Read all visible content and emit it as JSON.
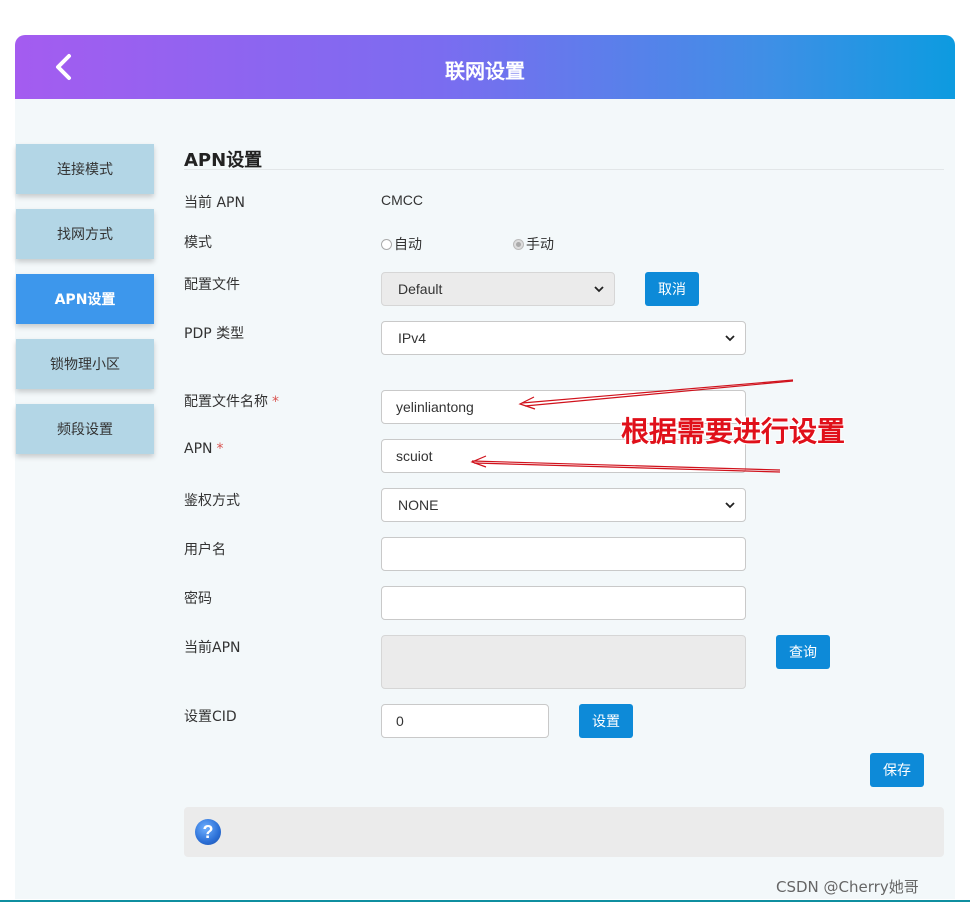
{
  "header": {
    "title": "联网设置"
  },
  "sidebar": {
    "items": [
      {
        "label": "连接模式",
        "active": false
      },
      {
        "label": "找网方式",
        "active": false
      },
      {
        "label": "APN设置",
        "active": true
      },
      {
        "label": "锁物理小区",
        "active": false
      },
      {
        "label": "频段设置",
        "active": false
      }
    ]
  },
  "section": {
    "title": "APN设置"
  },
  "form": {
    "current_apn_label": "当前 APN",
    "current_apn_value": "CMCC",
    "mode_label": "模式",
    "mode_options": [
      {
        "label": "自动",
        "checked": false
      },
      {
        "label": "手动",
        "checked": true
      }
    ],
    "profile_label": "配置文件",
    "profile_value": "Default",
    "cancel_label": "取消",
    "pdp_label": "PDP 类型",
    "pdp_value": "IPv4",
    "profile_name_label": "配置文件名称",
    "profile_name_value": "yelinliantong",
    "apn_label": "APN",
    "apn_value": "scuiot",
    "required_mark": "*",
    "auth_label": "鉴权方式",
    "auth_value": "NONE",
    "username_label": "用户名",
    "username_value": "",
    "password_label": "密码",
    "password_value": "",
    "current_apn2_label": "当前APN",
    "current_apn2_value": "",
    "query_label": "查询",
    "cid_label": "设置CID",
    "cid_value": "0",
    "set_label": "设置",
    "save_label": "保存"
  },
  "annotation": {
    "text": "根据需要进行设置",
    "color": "#e0101a"
  },
  "help": {
    "icon": "question-icon",
    "glyph": "?"
  },
  "watermark": "CSDN @Cherry她哥",
  "colors": {
    "header_gradient": [
      "#a45cf0",
      "#0d9be0"
    ],
    "sidebar_item": "#b3d6e6",
    "sidebar_active": "#3d97ec",
    "button": "#0d8ad8",
    "panel_bg": "#f3f8fa"
  }
}
